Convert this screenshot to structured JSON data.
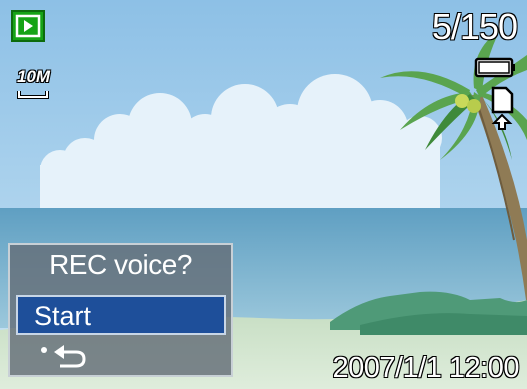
{
  "screen": {
    "mode_icon": "playback-icon",
    "image_counter": "5/150",
    "resolution_label": "10M",
    "battery_icon": "battery-icon",
    "memory_card_icon": "memory-card-icon",
    "timestamp": "2007/1/1 12:00"
  },
  "rec_menu": {
    "title": "REC voice?",
    "options": [
      {
        "label": "Start",
        "selected": true
      },
      {
        "label": "",
        "icon": "back-return-icon",
        "selected": false
      }
    ]
  },
  "colors": {
    "sky": "#a9d1ec",
    "sea": "#6fa9c6",
    "sand": "#cfe3c6",
    "mode_badge": "#16a316",
    "menu_highlight": "#1e4f9a"
  }
}
